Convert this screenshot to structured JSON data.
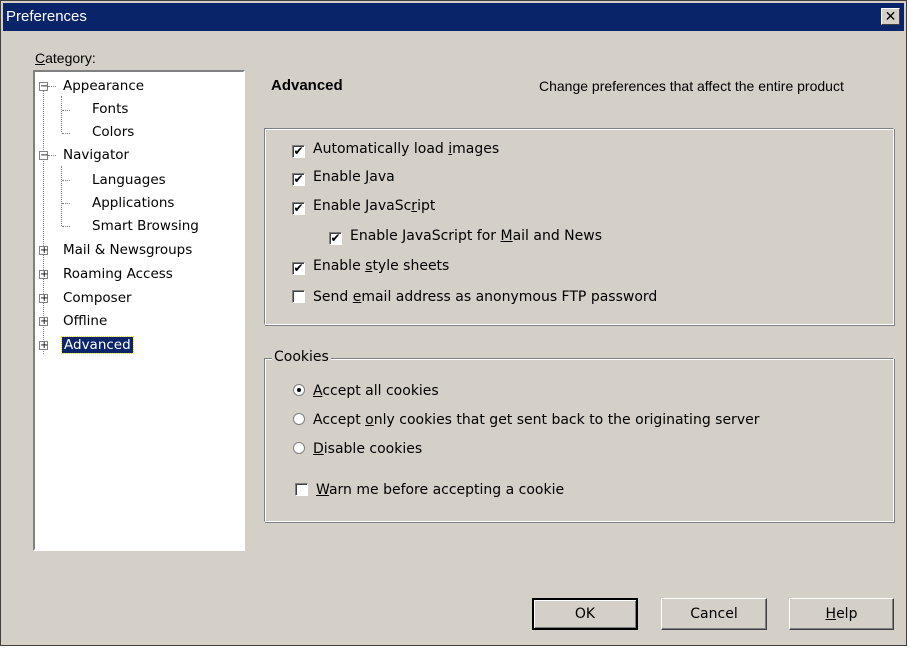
{
  "window": {
    "title": "Preferences",
    "close_glyph": "✕"
  },
  "category": {
    "label_prefix": "",
    "label_underlined": "C",
    "label_rest": "ategory:"
  },
  "tree": [
    {
      "label": "Appearance",
      "level": 0,
      "toggle": "⊟"
    },
    {
      "label": "Fonts",
      "level": 1
    },
    {
      "label": "Colors",
      "level": 1
    },
    {
      "label": "Navigator",
      "level": 0,
      "toggle": "⊟"
    },
    {
      "label": "Languages",
      "level": 1
    },
    {
      "label": "Applications",
      "level": 1
    },
    {
      "label": "Smart Browsing",
      "level": 1
    },
    {
      "label": "Mail & Newsgroups",
      "level": 0,
      "toggle": "⊞"
    },
    {
      "label": "Roaming Access",
      "level": 0,
      "toggle": "⊞"
    },
    {
      "label": "Composer",
      "level": 0,
      "toggle": "⊞"
    },
    {
      "label": "Offline",
      "level": 0,
      "toggle": "⊞"
    },
    {
      "label": "Advanced",
      "level": 0,
      "toggle": "⊞",
      "selected": true
    }
  ],
  "panel": {
    "title": "Advanced",
    "description": "Change preferences that affect the entire product"
  },
  "options": [
    {
      "pre": "Automatically load ",
      "u": "i",
      "post": "mages",
      "checked": true
    },
    {
      "pre": "Enable ",
      "u": "J",
      "post": "ava",
      "checked": true
    },
    {
      "pre": "Enable JavaSc",
      "u": "r",
      "post": "ipt",
      "checked": true
    },
    {
      "pre": "Enable JavaScript for ",
      "u": "M",
      "post": "ail and News",
      "checked": true
    },
    {
      "pre": "Enable ",
      "u": "s",
      "post": "tyle sheets",
      "checked": true
    },
    {
      "pre": "Send ",
      "u": "e",
      "post": "mail address as anonymous FTP password",
      "checked": false
    }
  ],
  "cookies": {
    "legend": "Cookies",
    "radios": [
      {
        "pre": "",
        "u": "A",
        "post": "ccept all cookies",
        "selected": true
      },
      {
        "pre": "Accept ",
        "u": "o",
        "post": "nly cookies that get sent back to the originating server",
        "selected": false
      },
      {
        "pre": "",
        "u": "D",
        "post": "isable cookies",
        "selected": false
      }
    ],
    "warn": {
      "pre": "",
      "u": "W",
      "post": "arn me before accepting a cookie",
      "checked": false
    }
  },
  "check_glyph": "✔",
  "buttons": {
    "ok": "OK",
    "cancel": "Cancel",
    "help_u": "H",
    "help_rest": "elp"
  }
}
